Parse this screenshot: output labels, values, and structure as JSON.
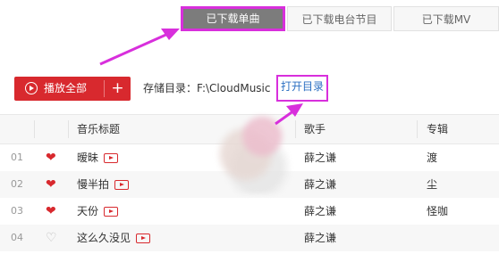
{
  "tabs": [
    {
      "label": "已下载单曲",
      "active": true
    },
    {
      "label": "已下载电台节目",
      "active": false
    },
    {
      "label": "已下载MV",
      "active": false
    }
  ],
  "toolbar": {
    "play_all_label": "播放全部",
    "add_label": "+",
    "storage_label": "存储目录：F:\\CloudMusic",
    "open_dir_label": "打开目录"
  },
  "table": {
    "headers": {
      "title": "音乐标题",
      "artist": "歌手",
      "album": "专辑"
    },
    "rows": [
      {
        "num": "01",
        "liked": true,
        "title": "暧昧",
        "artist": "薛之谦",
        "album": "渡"
      },
      {
        "num": "02",
        "liked": true,
        "title": "慢半拍",
        "artist": "薛之谦",
        "album": "尘"
      },
      {
        "num": "03",
        "liked": true,
        "title": "天份",
        "artist": "薛之谦",
        "album": "怪咖"
      },
      {
        "num": "04",
        "liked": false,
        "title": "这么久没见",
        "artist": "薛之谦",
        "album": ""
      }
    ]
  },
  "colors": {
    "accent": "#d8292e",
    "highlight": "#d82fdc",
    "link": "#2b6fc2"
  }
}
